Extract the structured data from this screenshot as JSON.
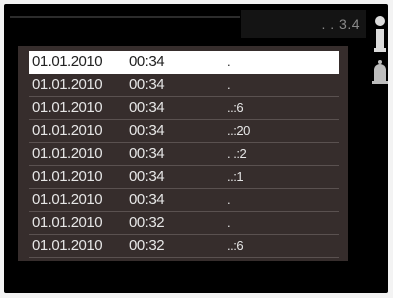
{
  "header": {
    "title": ". . 3.4"
  },
  "icons": {
    "info": "info-icon",
    "alarm": "bell-icon"
  },
  "log": {
    "rows": [
      {
        "date": "01.01.2010",
        "time": "00:34",
        "alarm": "."
      },
      {
        "date": "01.01.2010",
        "time": "00:34",
        "alarm": "."
      },
      {
        "date": "01.01.2010",
        "time": "00:34",
        "alarm": "..:6"
      },
      {
        "date": "01.01.2010",
        "time": "00:34",
        "alarm": "..:20"
      },
      {
        "date": "01.01.2010",
        "time": "00:34",
        "alarm": ". .:2"
      },
      {
        "date": "01.01.2010",
        "time": "00:34",
        "alarm": "..:1"
      },
      {
        "date": "01.01.2010",
        "time": "00:34",
        "alarm": "."
      },
      {
        "date": "01.01.2010",
        "time": "00:32",
        "alarm": "."
      },
      {
        "date": "01.01.2010",
        "time": "00:32",
        "alarm": "..:6"
      }
    ]
  },
  "colors": {
    "background": "#000000",
    "panel": "#362d2c",
    "selected_row": "#ffffff",
    "text": "#e6e6e6"
  }
}
